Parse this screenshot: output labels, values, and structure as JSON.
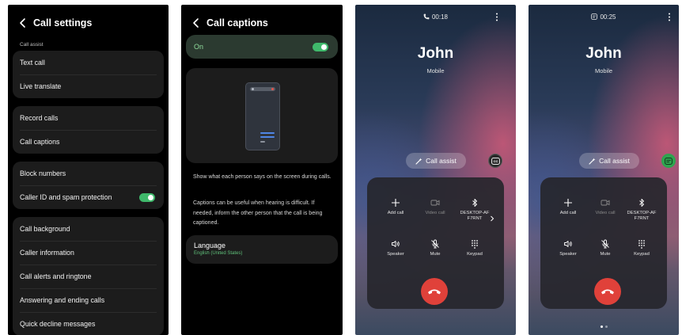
{
  "call_settings": {
    "title": "Call settings",
    "section_label": "Call assist",
    "groups": [
      [
        {
          "label": "Text call"
        },
        {
          "label": "Live translate"
        }
      ],
      [
        {
          "label": "Record calls"
        },
        {
          "label": "Call captions"
        }
      ],
      [
        {
          "label": "Block numbers"
        },
        {
          "label": "Caller ID and spam protection",
          "toggle": true
        }
      ],
      [
        {
          "label": "Call background"
        },
        {
          "label": "Caller information"
        },
        {
          "label": "Call alerts and ringtone"
        },
        {
          "label": "Answering and ending calls"
        },
        {
          "label": "Quick decline messages"
        }
      ]
    ]
  },
  "call_captions": {
    "title": "Call captions",
    "switch_label": "On",
    "switch_on": true,
    "desc1": "Show what each person says on the screen during calls.",
    "desc2": "Captions can be useful when hearing is difficult. If needed, inform the other person that the call is being captioned.",
    "language_title": "Language",
    "language_value": "English (United States)"
  },
  "call_screen_1": {
    "status_icon": "phone-icon",
    "timer": "00:18",
    "caller_name": "John",
    "caller_type": "Mobile",
    "assist_label": "Call assist",
    "captions_button": "captions-off-icon",
    "controls": {
      "add_call": "Add call",
      "video_call": "Video call",
      "bluetooth": "DESKTOP-AF F7RNT",
      "speaker": "Speaker",
      "mute": "Mute",
      "keypad": "Keypad"
    }
  },
  "call_screen_2": {
    "status_icon": "captions-icon",
    "timer": "00:25",
    "caller_name": "John",
    "caller_type": "Mobile",
    "assist_label": "Call assist",
    "captions_button": "captions-on-icon",
    "controls": {
      "add_call": "Add call",
      "video_call": "Video call",
      "bluetooth": "DESKTOP-AF F7RNT",
      "speaker": "Speaker",
      "mute": "Mute",
      "keypad": "Keypad"
    },
    "pager_count": 2,
    "pager_active": 1
  },
  "colors": {
    "toggle_on": "#3fb96b",
    "end_call": "#e0413a",
    "captions_on": "#2ea44f"
  }
}
